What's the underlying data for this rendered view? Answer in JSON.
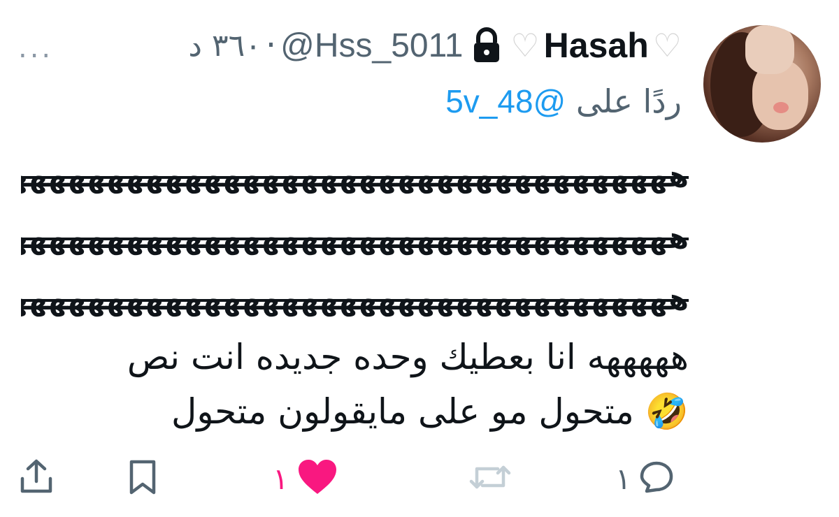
{
  "header": {
    "display_name": "Hasah",
    "handle": "@Hss_5011",
    "separator": "·",
    "time": "٣٦٠ د",
    "more": "..."
  },
  "reply": {
    "prefix": "ردًا على",
    "mention": "@5v_48"
  },
  "body": {
    "strikethrough_lines": [
      "هههههههههههههههههههههههههههههههههههههه",
      "هههههههههههههههههههههههههههههههههههههههه",
      "هههههههههههههههههههههههههههههههههههههههه"
    ],
    "line1": "هههههه انا بعطيك وحده جديده انت  نص",
    "line2": "متحول مو على مايقولون متحول",
    "emoji": "🤣"
  },
  "actions": {
    "reply_count": "١",
    "retweet_count": "",
    "like_count": "١"
  },
  "colors": {
    "accent": "#1d9bf0",
    "like": "#f91880",
    "muted": "#536471",
    "text": "#0f1419"
  }
}
